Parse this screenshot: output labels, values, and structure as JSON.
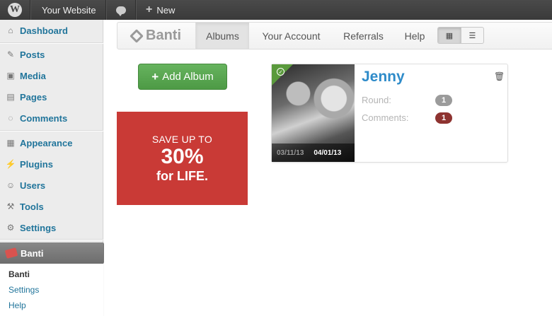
{
  "adminbar": {
    "site_name": "Your Website",
    "new_label": "New",
    "wp_logo_glyph": "W"
  },
  "sidebar": {
    "items": [
      {
        "label": "Dashboard",
        "icon": "house-icon"
      },
      {
        "label": "Posts",
        "icon": "pin-icon"
      },
      {
        "label": "Media",
        "icon": "media-icon"
      },
      {
        "label": "Pages",
        "icon": "pages-icon"
      },
      {
        "label": "Comments",
        "icon": "comment-icon"
      },
      {
        "label": "Appearance",
        "icon": "appearance-icon"
      },
      {
        "label": "Plugins",
        "icon": "plugin-icon"
      },
      {
        "label": "Users",
        "icon": "users-icon"
      },
      {
        "label": "Tools",
        "icon": "tools-icon"
      },
      {
        "label": "Settings",
        "icon": "settings-icon"
      }
    ],
    "active": {
      "label": "Banti",
      "icon": "banti-tag-icon"
    },
    "submenu": [
      {
        "label": "Banti",
        "current": true
      },
      {
        "label": "Settings",
        "current": false
      },
      {
        "label": "Help",
        "current": false
      }
    ]
  },
  "plugin_nav": {
    "brand": "Banti",
    "tabs": [
      {
        "label": "Albums",
        "active": true
      },
      {
        "label": "Your Account",
        "active": false
      },
      {
        "label": "Referrals",
        "active": false
      },
      {
        "label": "Help",
        "active": false
      }
    ],
    "view_toggle_active": "grid"
  },
  "add_album_label": "Add Album",
  "promo": {
    "line1": "SAVE UP TO",
    "line2": "30%",
    "line3": "for LIFE."
  },
  "album": {
    "name": "Jenny",
    "date_start": "03/11/13",
    "date_end": "04/01/13",
    "round_label": "Round:",
    "round_value": "1",
    "comments_label": "Comments:",
    "comments_value": "1"
  },
  "colors": {
    "link": "#21759b",
    "accent_green": "#5cac53",
    "promo_red": "#c93a36",
    "album_name": "#2e8bc9",
    "badge_gray": "#9b9b9b",
    "badge_red": "#8e3330"
  }
}
